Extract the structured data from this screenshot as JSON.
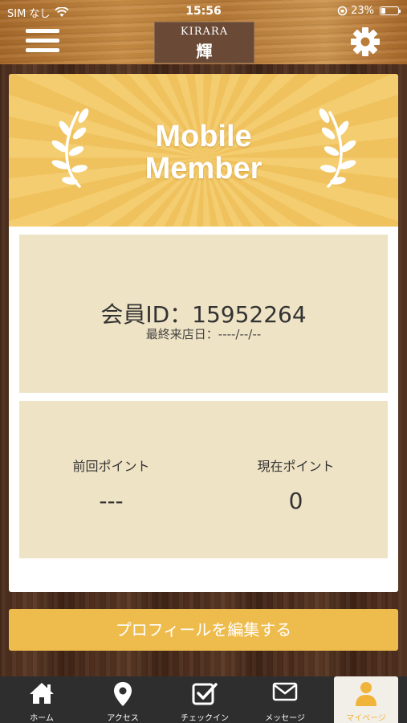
{
  "status_bar": {
    "carrier": "SIM なし",
    "time": "15:56",
    "battery": "23%"
  },
  "header": {
    "logo_top": "KIRARA",
    "logo_kanji": "輝"
  },
  "banner": {
    "title_line1": "Mobile",
    "title_line2": "Member"
  },
  "member": {
    "id_text": "会員ID：15952264",
    "last_visit": "最終来店日：----/--/--"
  },
  "points": {
    "previous_label": "前回ポイント",
    "previous_value": "---",
    "current_label": "現在ポイント",
    "current_value": "0"
  },
  "edit_button": "プロフィールを編集する",
  "tabs": [
    {
      "label": "ホーム",
      "icon": "home-icon"
    },
    {
      "label": "アクセス",
      "icon": "location-pin-icon"
    },
    {
      "label": "チェックイン",
      "icon": "checkbox-icon"
    },
    {
      "label": "メッセージ",
      "icon": "envelope-icon"
    },
    {
      "label": "マイページ",
      "icon": "person-icon",
      "active": true
    }
  ],
  "colors": {
    "accent": "#eebc4c",
    "banner": "#f2c865",
    "panel": "#efe3c5",
    "tabbar": "#2e2e2e"
  }
}
